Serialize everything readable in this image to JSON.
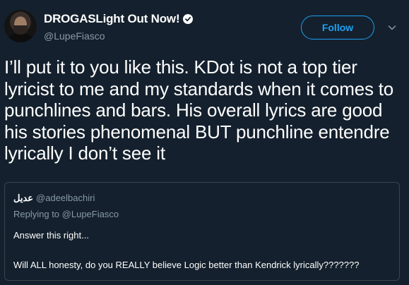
{
  "tweet": {
    "author": {
      "display_name": "DROGASLight Out Now!",
      "handle": "@LupeFiasco",
      "verified": true
    },
    "follow_label": "Follow",
    "text": "I’ll put it to you like this. KDot is not a top tier lyricist to me and my standards when it comes to punchlines and bars. His overall lyrics are good his stories phenomenal BUT punchline entendre lyrically I don’t see it",
    "quoted": {
      "name": "عديل",
      "handle": "@adeelbachiri",
      "replying_prefix": "Replying to",
      "replying_to": "@LupeFiasco",
      "line1": "Answer this right...",
      "line2": "Will ALL honesty, do you REALLY believe Logic better than Kendrick lyrically???????"
    }
  },
  "colors": {
    "background": "#14202d",
    "accent": "#1da1f2",
    "secondary_text": "#8899a6",
    "border": "#38444d"
  },
  "icons": {
    "verified": "verified-badge-icon",
    "caret": "chevron-down-icon"
  }
}
